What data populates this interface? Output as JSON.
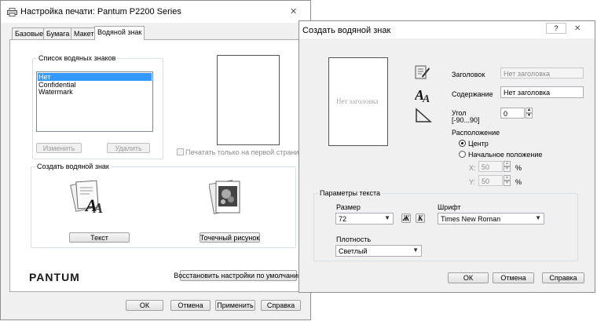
{
  "print_dialog": {
    "title": "Настройка печати: Pantum P2200 Series",
    "tabs": [
      {
        "label": "Базовые"
      },
      {
        "label": "Бумага"
      },
      {
        "label": "Макет"
      },
      {
        "label": "Водяной знак"
      }
    ],
    "watermark_list": {
      "group_label": "Список водяных знаков",
      "items": [
        "Нет",
        "Confidential",
        "Watermark"
      ],
      "selected": "Нет",
      "edit_label": "Изменить",
      "delete_label": "Удалить"
    },
    "first_page_only_label": "Печатать только на первой странице",
    "create_group_label": "Создать водяной знак",
    "text_button": "Текст",
    "bitmap_button": "Точечный рисунок",
    "logo": "PANTUM",
    "restore_defaults": "Восстановить настройки по умолчанию",
    "ok": "ОК",
    "cancel": "Отмена",
    "apply": "Применить",
    "help": "Справка"
  },
  "watermark_dialog": {
    "title": "Создать водяной знак",
    "help_glyph": "?",
    "preview_text": "Нет заголовка",
    "header_label": "Заголовок",
    "header_value": "Нет заголовка",
    "content_label": "Содержание",
    "content_value": "Нет заголовка",
    "angle_label": "Угол",
    "angle_range": "[-90...90]",
    "angle_value": "0",
    "position_label": "Расположение",
    "center_label": "Центр",
    "start_position_label": "Начальное положение",
    "x_label": "X:",
    "x_value": "50",
    "y_label": "Y:",
    "y_value": "50",
    "percent": "%",
    "text_params_label": "Параметры текста",
    "size_label": "Размер",
    "size_value": "72",
    "bold_glyph": "Ж",
    "italic_glyph": "К",
    "font_label": "Шрифт",
    "font_value": "Times New Roman",
    "density_label": "Плотность",
    "density_value": "Светлый",
    "ok": "ОК",
    "cancel": "Отмена",
    "help": "Справка"
  },
  "close_glyph": "✕",
  "colors": {
    "selection": "#3399ff",
    "dialog_bg": "#f0f0f0",
    "titlebar": "#ffffff",
    "border": "#8e8f8f"
  }
}
